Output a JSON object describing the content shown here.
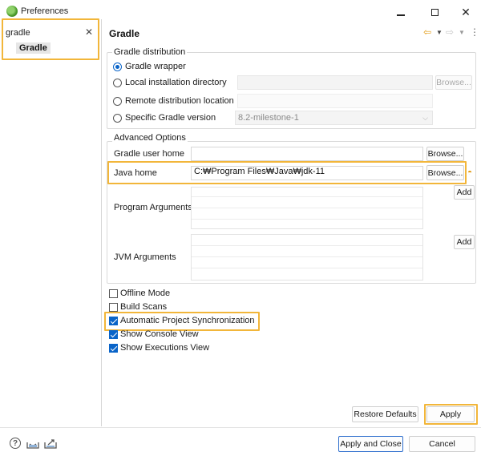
{
  "window": {
    "title": "Preferences",
    "minimize_icon": "minimize-icon",
    "maximize_icon": "maximize-icon",
    "close_icon": "close-icon"
  },
  "sidebar": {
    "filter_value": "gradle",
    "clear_icon": "✕",
    "tree_items": [
      {
        "label": "Gradle",
        "selected": true
      }
    ]
  },
  "page": {
    "title": "Gradle",
    "nav_icons": [
      "back-arrow-icon",
      "dropdown-icon",
      "forward-arrow-icon",
      "dropdown-icon",
      "view-menu-icon"
    ]
  },
  "distribution": {
    "group_label": "Gradle distribution",
    "options": [
      {
        "label": "Gradle wrapper",
        "checked": true
      },
      {
        "label": "Local installation directory",
        "checked": false
      },
      {
        "label": "Remote distribution location",
        "checked": false
      },
      {
        "label": "Specific Gradle version",
        "checked": false
      }
    ],
    "browse_label": "Browse...",
    "version_value": "8.2-milestone-1"
  },
  "advanced": {
    "group_label": "Advanced Options",
    "user_home_label": "Gradle user home",
    "user_home_value": "",
    "user_home_browse": "Browse...",
    "java_home_label": "Java home",
    "java_home_value": "C:₩Program Files₩Java₩jdk-11",
    "java_home_browse": "Browse...",
    "program_args_label": "Program Arguments",
    "program_args_add": "Add",
    "jvm_args_label": "JVM Arguments",
    "jvm_args_add": "Add"
  },
  "options": [
    {
      "label": "Offline Mode",
      "checked": false
    },
    {
      "label": "Build Scans",
      "checked": false
    },
    {
      "label": "Automatic Project Synchronization",
      "checked": true
    },
    {
      "label": "Show Console View",
      "checked": true
    },
    {
      "label": "Show Executions View",
      "checked": true
    }
  ],
  "buttons": {
    "restore_defaults": "Restore Defaults",
    "apply": "Apply",
    "apply_and_close": "Apply and Close",
    "cancel": "Cancel"
  },
  "footer": {
    "help_glyph": "?",
    "import_icon": "import-icon",
    "export_icon": "export-icon"
  },
  "colors": {
    "highlight": "#f2b63a",
    "accent": "#0a64c8"
  }
}
